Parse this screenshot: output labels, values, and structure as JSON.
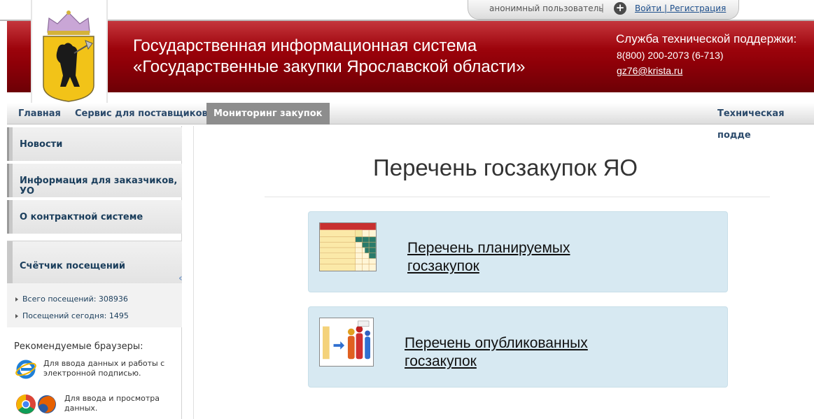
{
  "auth": {
    "user": "анонимный пользователь",
    "separator": "|",
    "links": "Войти | Регистрация"
  },
  "header": {
    "title_line1": "Государственная информационная система",
    "title_line2": "«Государственные закупки Ярославской области»",
    "support_title": "Служба технической поддержки:",
    "support_phone": "8(800) 200-2073 (6-713)",
    "support_email": "gz76@krista.ru"
  },
  "nav": {
    "items": [
      "Главная",
      "Сервис для поставщиков",
      "Мониторинг закупок",
      "Техническая подде"
    ],
    "active": "Мониторинг закупок"
  },
  "sidebar": {
    "items": [
      "Новости",
      "Информация для заказчиков, УО",
      "О контрактной системе"
    ],
    "counter": {
      "title": "Счётчик посещений",
      "total": "Всего посещений: 308936",
      "today": "Посещений сегодня: 1495"
    },
    "browsers": {
      "title": "Рекомендуемые браузеры:",
      "ie_text": "Для ввода данных и работы с электронной подписью.",
      "other_text": "Для ввода и просмотра данных."
    }
  },
  "main": {
    "title": "Перечень госзакупок ЯО",
    "cards": [
      {
        "line1": "Перечень планируемых",
        "line2": "госзакупок"
      },
      {
        "line1": "Перечень опубликованных",
        "line2": "госзакупок"
      }
    ]
  },
  "colors": {
    "header_red": "#9e0a10",
    "nav_active": "#8d8d8d",
    "card_bg": "#d7e9f2",
    "link_blue": "#1e4f8c"
  }
}
